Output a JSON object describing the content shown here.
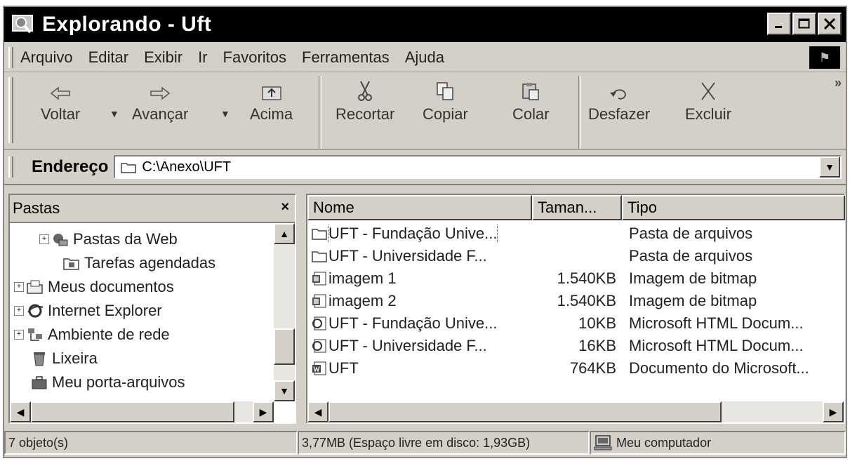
{
  "window": {
    "title": "Explorando - Uft"
  },
  "menu": [
    "Arquivo",
    "Editar",
    "Exibir",
    "Ir",
    "Favoritos",
    "Ferramentas",
    "Ajuda"
  ],
  "toolbar": {
    "back": "Voltar",
    "forward": "Avançar",
    "up": "Acima",
    "cut": "Recortar",
    "copy": "Copiar",
    "paste": "Colar",
    "undo": "Desfazer",
    "delete": "Excluir"
  },
  "address": {
    "label": "Endereço",
    "value": "C:\\Anexo\\UFT"
  },
  "folders": {
    "title": "Pastas",
    "close": "×",
    "items": [
      {
        "label": "Pastas da Web",
        "icon": "web-folders-icon",
        "expandable": true
      },
      {
        "label": "Tarefas agendadas",
        "icon": "scheduled-tasks-icon",
        "expandable": false
      },
      {
        "label": "Meus documentos",
        "icon": "my-documents-icon",
        "expandable": true
      },
      {
        "label": "Internet Explorer",
        "icon": "internet-explorer-icon",
        "expandable": true
      },
      {
        "label": "Ambiente de rede",
        "icon": "network-icon",
        "expandable": true
      },
      {
        "label": "Lixeira",
        "icon": "recycle-bin-icon",
        "expandable": false
      },
      {
        "label": "Meu porta-arquivos",
        "icon": "briefcase-icon",
        "expandable": false
      }
    ]
  },
  "files": {
    "columns": [
      "Nome",
      "Taman...",
      "Tipo"
    ],
    "rows": [
      {
        "name": "UFT - Fundação Unive...",
        "size": "",
        "type": "Pasta de arquivos",
        "icon": "folder-icon"
      },
      {
        "name": "UFT - Universidade F...",
        "size": "",
        "type": "Pasta de arquivos",
        "icon": "folder-icon"
      },
      {
        "name": "imagem 1",
        "size": "1.540KB",
        "type": "Imagem de bitmap",
        "icon": "bitmap-icon"
      },
      {
        "name": "imagem 2",
        "size": "1.540KB",
        "type": "Imagem de bitmap",
        "icon": "bitmap-icon"
      },
      {
        "name": "UFT - Fundação Unive...",
        "size": "10KB",
        "type": "Microsoft HTML Docum...",
        "icon": "html-document-icon"
      },
      {
        "name": "UFT - Universidade F...",
        "size": "16KB",
        "type": "Microsoft HTML Docum...",
        "icon": "html-document-icon"
      },
      {
        "name": "UFT",
        "size": "764KB",
        "type": "Documento do Microsoft...",
        "icon": "word-document-icon"
      }
    ]
  },
  "status": {
    "objects": "7 objeto(s)",
    "disk": "3,77MB (Espaço livre em disco: 1,93GB)",
    "location": "Meu computador"
  }
}
